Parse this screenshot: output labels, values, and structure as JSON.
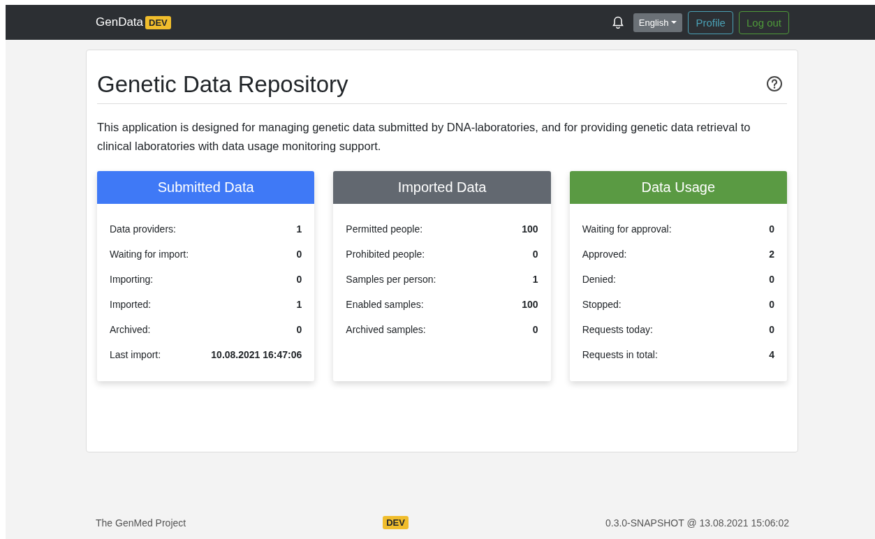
{
  "navbar": {
    "brand": "GenData",
    "env_badge": "DEV",
    "language": "English",
    "buttons": [
      {
        "label": "Profile",
        "kind": "info"
      },
      {
        "label": "Log out",
        "kind": "success"
      }
    ]
  },
  "page": {
    "title": "Genetic Data Repository",
    "intro": "This application is designed for managing genetic data submitted by DNA-laboratories, and for providing genetic data retrieval to clinical laboratories with data usage monitoring support."
  },
  "cards": [
    {
      "title": "Submitted Data",
      "color": "#3f79f6",
      "rows": [
        {
          "label": "Data providers:",
          "value": "1"
        },
        {
          "label": "Waiting for import:",
          "value": "0"
        },
        {
          "label": "Importing:",
          "value": "0"
        },
        {
          "label": "Imported:",
          "value": "1"
        },
        {
          "label": "Archived:",
          "value": "0"
        },
        {
          "label": "Last import:",
          "value": "10.08.2021 16:47:06"
        }
      ]
    },
    {
      "title": "Imported Data",
      "color": "#626870",
      "rows": [
        {
          "label": "Permitted people:",
          "value": "100"
        },
        {
          "label": "Prohibited people:",
          "value": "0"
        },
        {
          "label": "Samples per person:",
          "value": "1"
        },
        {
          "label": "Enabled samples:",
          "value": "100"
        },
        {
          "label": "Archived samples:",
          "value": "0"
        }
      ]
    },
    {
      "title": "Data Usage",
      "color": "#5a9a43",
      "rows": [
        {
          "label": "Waiting for approval:",
          "value": "0"
        },
        {
          "label": "Approved:",
          "value": "2"
        },
        {
          "label": "Denied:",
          "value": "0"
        },
        {
          "label": "Stopped:",
          "value": "0"
        },
        {
          "label": "Requests today:",
          "value": "0"
        },
        {
          "label": "Requests in total:",
          "value": "4"
        }
      ]
    }
  ],
  "footer": {
    "project": "The GenMed Project",
    "env_badge": "DEV",
    "version": "0.3.0-SNAPSHOT @ 13.08.2021 15:06:02"
  }
}
